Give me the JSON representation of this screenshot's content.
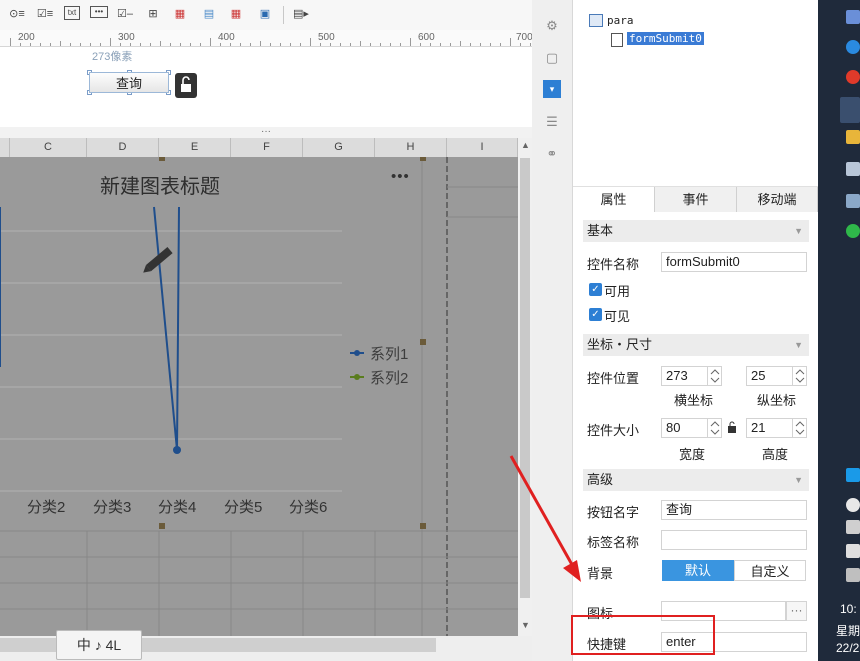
{
  "toolbar": {
    "icons": [
      "radio-list-icon",
      "checkbox-list-icon",
      "text-field-icon",
      "password-icon",
      "checkbox-icon",
      "tree-icon",
      "date-icon",
      "table-icon",
      "date-range-icon",
      "dropdown-icon",
      "report-icon"
    ]
  },
  "ruler": {
    "ticks": [
      "200",
      "300",
      "400",
      "500",
      "600",
      "700"
    ]
  },
  "design": {
    "pixel_label": "273像素",
    "query_button": "查询"
  },
  "grid": {
    "columns": [
      "C",
      "D",
      "E",
      "F",
      "G",
      "H",
      "I"
    ]
  },
  "chart_data": {
    "type": "line",
    "title": "新建图表标题",
    "categories": [
      "分类2",
      "分类3",
      "分类4",
      "分类5",
      "分类6"
    ],
    "series": [
      {
        "name": "系列1",
        "color": "#1f4e8c"
      },
      {
        "name": "系列2",
        "color": "#5a7d1e"
      }
    ],
    "legend_position": "right",
    "more_label": "•••"
  },
  "tree": {
    "root": "para",
    "child": "formSubmit0"
  },
  "tabs": [
    "属性",
    "事件",
    "移动端"
  ],
  "sections": {
    "basic": "基本",
    "coords": "坐标・尺寸",
    "advanced": "高级"
  },
  "fields": {
    "widget_name_label": "控件名称",
    "widget_name_value": "formSubmit0",
    "enabled_label": "可用",
    "visible_label": "可见",
    "position_label": "控件位置",
    "pos_x": "273",
    "pos_y": "25",
    "pos_x_label": "横坐标",
    "pos_y_label": "纵坐标",
    "size_label": "控件大小",
    "width": "80",
    "height": "21",
    "width_label": "宽度",
    "height_label": "高度",
    "button_name_label": "按钮名字",
    "button_name_value": "查询",
    "tag_name_label": "标签名称",
    "tag_name_value": "",
    "background_label": "背景",
    "bg_default": "默认",
    "bg_custom": "自定义",
    "icon_label": "图标",
    "icon_more": "···",
    "shortcut_label": "快捷键",
    "shortcut_value": "enter"
  },
  "ime": {
    "text": "中 ♪ 4L"
  },
  "taskbar": {
    "time": "10:",
    "weekday": "星期",
    "date": "22/2"
  },
  "colors": {
    "accent": "#2d7fd4",
    "highlight_red": "#e02020"
  }
}
